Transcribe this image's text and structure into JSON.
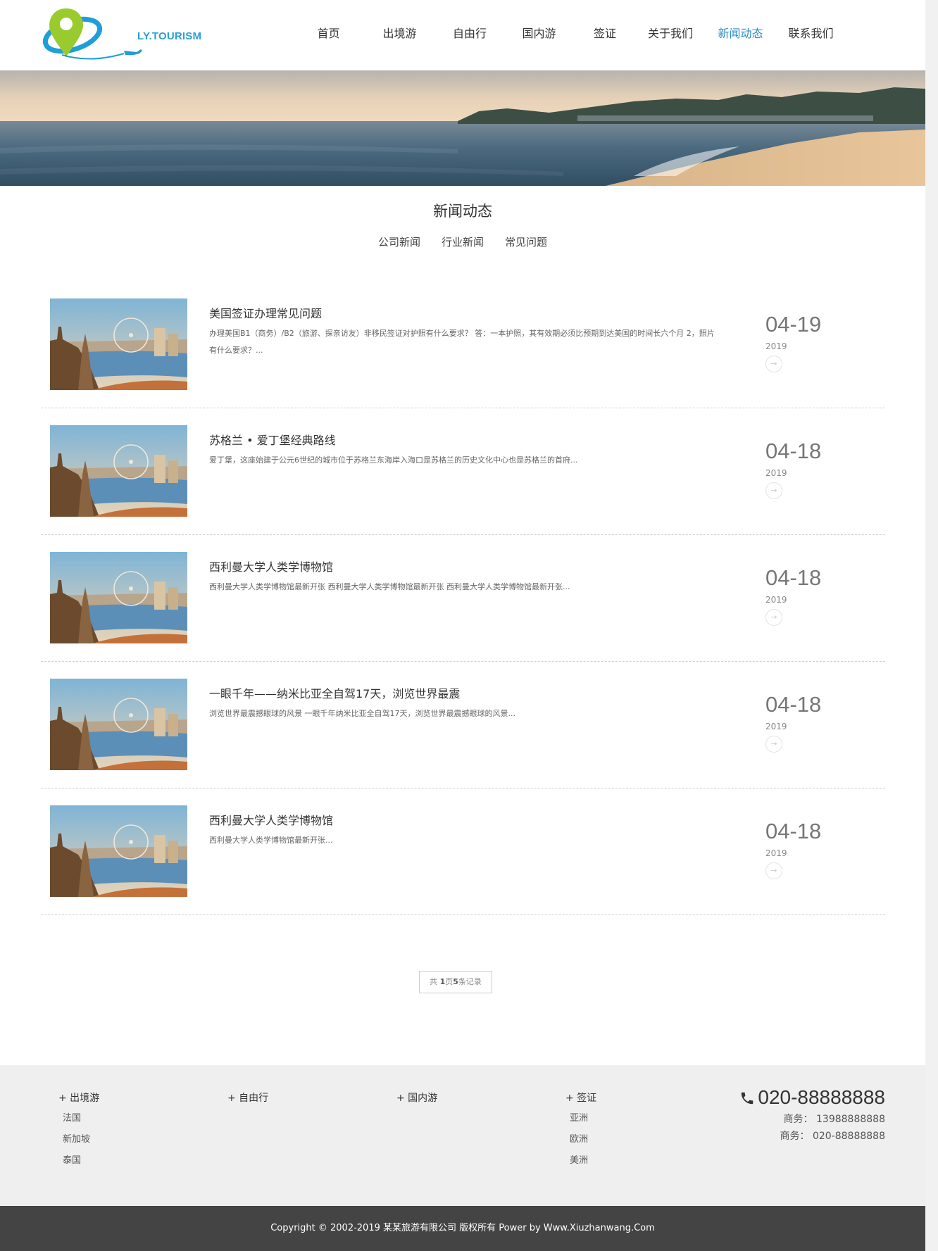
{
  "header": {
    "logo_text": "LY.TOURISM",
    "nav": [
      {
        "label": "首页"
      },
      {
        "label": "出境游"
      },
      {
        "label": "自由行"
      },
      {
        "label": "国内游"
      },
      {
        "label": "签证"
      },
      {
        "label": "关于我们"
      },
      {
        "label": "新闻动态",
        "active": true
      },
      {
        "label": "联系我们"
      }
    ]
  },
  "section": {
    "title": "新闻动态",
    "tabs": [
      "公司新闻",
      "行业新闻",
      "常见问题"
    ]
  },
  "news": [
    {
      "title": "美国签证办理常见问题",
      "desc": "办理美国B1（商务）/B2（旅游、探亲访友）非移民签证对护照有什么要求？ 答：一本护照，其有效期必须比预期到达美国的时间长六个月 2，照片有什么要求？...",
      "date": "04-19",
      "year": "2019"
    },
    {
      "title": "苏格兰 • 爱丁堡经典路线",
      "desc": "爱丁堡，这座始建于公元6世纪的城市位于苏格兰东海岸入海口是苏格兰的历史文化中心也是苏格兰的首府...",
      "date": "04-18",
      "year": "2019"
    },
    {
      "title": "西利曼大学人类学博物馆",
      "desc": "西利曼大学人类学博物馆最新开张 西利曼大学人类学博物馆最新开张 西利曼大学人类学博物馆最新开张...",
      "date": "04-18",
      "year": "2019"
    },
    {
      "title": "一眼千年——纳米比亚全自驾17天，浏览世界最震",
      "desc": "浏览世界最震撼眼球的风景 一眼千年纳米比亚全自驾17天，浏览世界最震撼眼球的风景...",
      "date": "04-18",
      "year": "2019"
    },
    {
      "title": "西利曼大学人类学博物馆",
      "desc": "西利曼大学人类学博物馆最新开张...",
      "date": "04-18",
      "year": "2019"
    }
  ],
  "more_glyph": "→",
  "pagination": {
    "prefix": "共 ",
    "pages": "1",
    "mid": "页",
    "records": "5",
    "suffix": "条记录"
  },
  "footer": {
    "columns": [
      {
        "title": "+ 出境游",
        "links": [
          "法国",
          "新加坡",
          "泰国"
        ]
      },
      {
        "title": "+ 自由行",
        "links": []
      },
      {
        "title": "+ 国内游",
        "links": []
      },
      {
        "title": "+ 签证",
        "links": [
          "亚洲",
          "欧洲",
          "美洲"
        ]
      }
    ],
    "phone": "020-88888888",
    "lines": [
      "商务： 13988888888",
      "商务： 020-88888888"
    ]
  },
  "copyright": "Copyright © 2002-2019 某某旅游有限公司 版权所有 Power by Www.Xiuzhanwang.Com",
  "colors": {
    "accent": "#2a8cc8",
    "footer_bg": "#efefef",
    "copyright_bg": "#444444"
  }
}
